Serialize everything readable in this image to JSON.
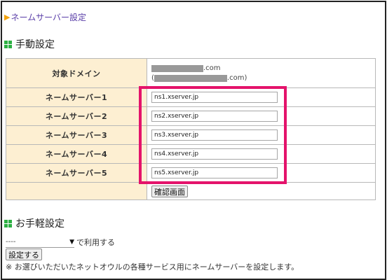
{
  "breadcrumb": {
    "label": "ネームサーバー設定"
  },
  "manual": {
    "title": "手動設定",
    "domain_label": "対象ドメイン",
    "domain_suffix": ".com",
    "domain_suffix_paren": "(",
    "domain_suffix_paren_end": ".com)",
    "nameservers": [
      {
        "label": "ネームサーバー1",
        "value": "ns1.xserver.jp"
      },
      {
        "label": "ネームサーバー2",
        "value": "ns2.xserver.jp"
      },
      {
        "label": "ネームサーバー3",
        "value": "ns3.xserver.jp"
      },
      {
        "label": "ネームサーバー4",
        "value": "ns4.xserver.jp"
      },
      {
        "label": "ネームサーバー5",
        "value": "ns5.xserver.jp"
      }
    ],
    "confirm_button": "確認画面"
  },
  "easy": {
    "title": "お手軽設定",
    "select_value": "----",
    "select_suffix": "で利用する",
    "set_button": "設定する",
    "note": "※ お選びいただいたネットオウルの各種サービス用にネームサーバーを設定します。"
  },
  "colors": {
    "label_bg": "#fdefd2",
    "highlight": "#e4136b",
    "section_icon": "#2db043",
    "breadcrumb": "#5a3ea8"
  }
}
